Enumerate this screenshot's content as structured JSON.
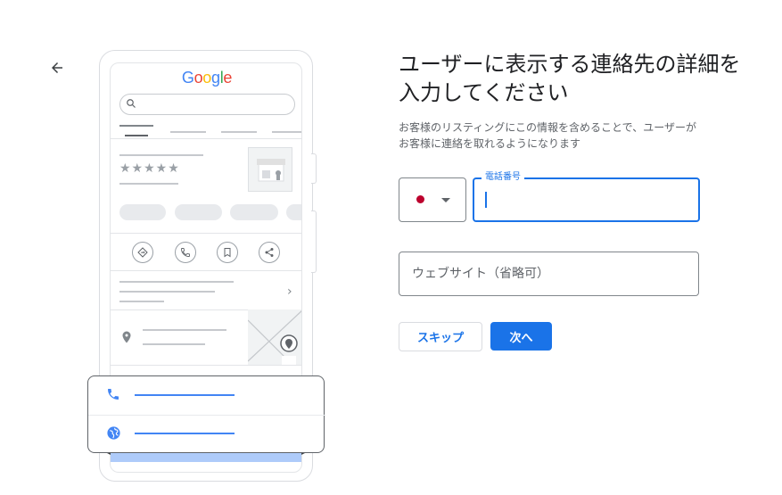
{
  "nav": {
    "back_icon": "arrow-back-icon"
  },
  "illustration": {
    "logo_text": "Google",
    "logo_colors": [
      "#4285f4",
      "#ea4335",
      "#fbbc05",
      "#4285f4",
      "#34a853",
      "#ea4335"
    ],
    "rating_stars": "★★★★★",
    "action_icons": [
      "directions-icon",
      "phone-icon",
      "bookmark-icon",
      "share-icon"
    ],
    "contact_icons": [
      "phone-icon",
      "globe-icon"
    ]
  },
  "form": {
    "title": "ユーザーに表示する連絡先の詳細を入力してください",
    "description": "お客様のリスティングにこの情報を含めることで、ユーザーがお客様に連絡を取れるようになります",
    "country_flag_color": "#bc002d",
    "phone_label": "電話番号",
    "phone_value": "",
    "website_placeholder": "ウェブサイト（省略可）",
    "skip_label": "スキップ",
    "next_label": "次へ"
  },
  "colors": {
    "accent": "#1a73e8",
    "text": "#202124",
    "muted": "#5f6368"
  }
}
